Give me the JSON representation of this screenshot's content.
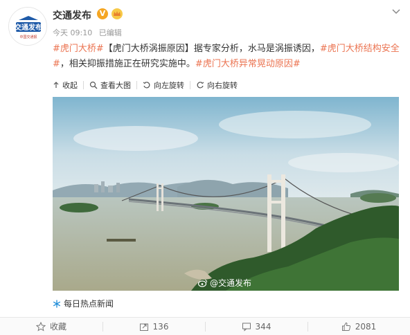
{
  "account": {
    "name": "交通发布",
    "verified": "V",
    "avatar_title": "交通发布",
    "avatar_subtitle": "中国交通报"
  },
  "meta": {
    "time": "今天 09:10",
    "edited": "已编辑"
  },
  "post": {
    "tag1": "#虎门大桥#",
    "headline": "【虎门大桥涡振原因】",
    "text1": "据专家分析，水马是涡振诱因，",
    "tag2": "#虎门大桥结构安全#",
    "text2": "，相关抑振措施正在研究实施中。",
    "tag3": "#虎门大桥异常晃动原因#"
  },
  "toolbar": {
    "collapse": "收起",
    "view_large": "查看大图",
    "rotate_left": "向左旋转",
    "rotate_right": "向右旋转"
  },
  "image": {
    "watermark": "@交通发布"
  },
  "source": {
    "label": "每日热点新闻"
  },
  "footer": {
    "favorite": "收藏",
    "repost_count": "136",
    "comment_count": "344",
    "like_count": "2081"
  },
  "colors": {
    "accent": "#eb7350",
    "verified": "#f5a623",
    "link_blue": "#1e5aa8"
  }
}
